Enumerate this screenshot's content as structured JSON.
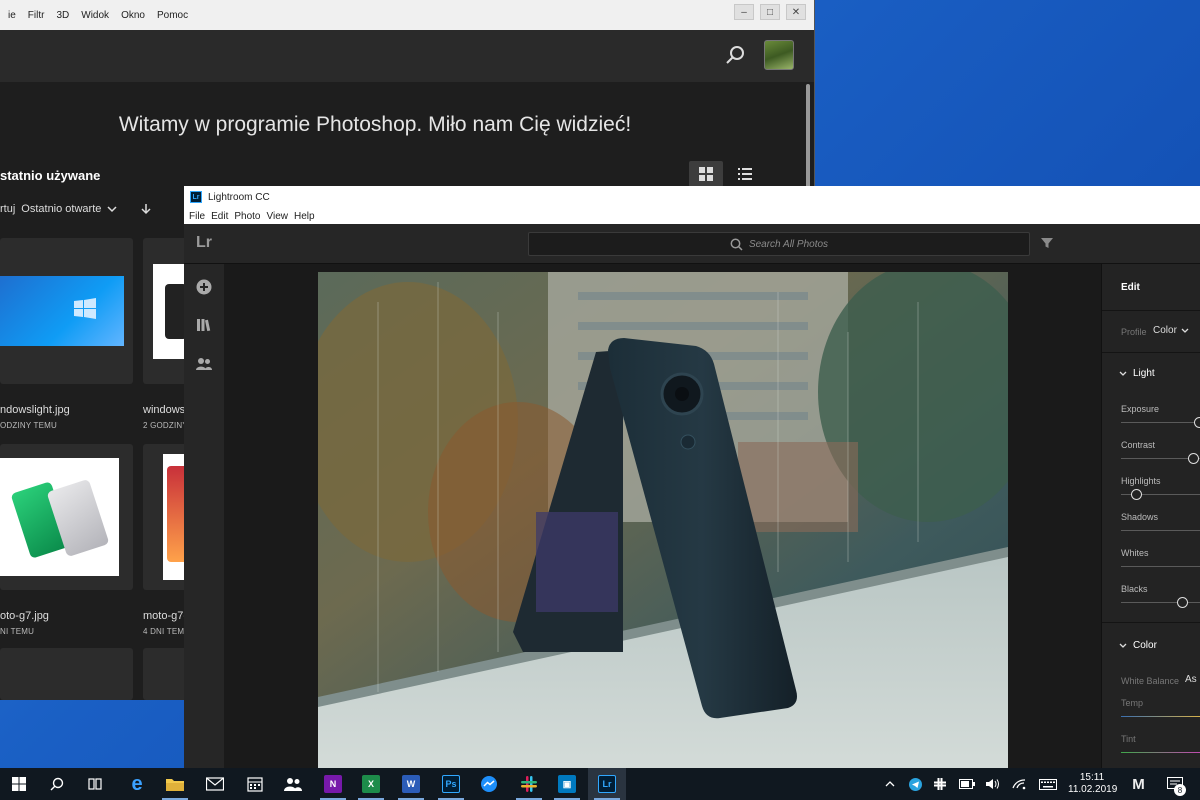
{
  "photoshop": {
    "menu": [
      "ie",
      "Filtr",
      "3D",
      "Widok",
      "Okno",
      "Pomoc"
    ],
    "welcome": "Witamy w programie Photoshop. Miło nam Cię widzieć!",
    "recent_heading": "statnio używane",
    "sort_prefix": "rtuj",
    "sort_value": "Ostatnio otwarte",
    "files": [
      {
        "name": "ndowslight.jpg",
        "meta": "ODZINY TEMU"
      },
      {
        "name": "windows",
        "meta": "2 GODZINY"
      },
      {
        "name": "oto-g7.jpg",
        "meta": "NI TEMU"
      },
      {
        "name": "moto-g7-",
        "meta": "4 DNI TEMU"
      }
    ]
  },
  "lightroom": {
    "title": "Lightroom CC",
    "brand": "Lr",
    "menu": [
      "File",
      "Edit",
      "Photo",
      "View",
      "Help"
    ],
    "search_placeholder": "Search All Photos",
    "panel": {
      "edit_label": "Edit",
      "profile_label": "Profile",
      "profile_value": "Color",
      "light_section": "Light",
      "sliders": [
        {
          "label": "Exposure",
          "value_fraction": 0.99
        },
        {
          "label": "Contrast",
          "value_fraction": 0.92
        },
        {
          "label": "Highlights",
          "value_fraction": 0.2
        },
        {
          "label": "Shadows",
          "value_fraction": null
        },
        {
          "label": "Whites",
          "value_fraction": null
        },
        {
          "label": "Blacks",
          "value_fraction": 0.78
        }
      ],
      "color_section": "Color",
      "white_balance_label": "White Balance",
      "white_balance_value": "As",
      "temp_label": "Temp",
      "tint_label": "Tint"
    }
  },
  "taskbar": {
    "apps": [
      "Start",
      "Search",
      "Task View",
      "Edge",
      "File Explorer",
      "Mail",
      "Calendar",
      "People",
      "OneNote",
      "Excel",
      "Word",
      "Photoshop",
      "Messenger",
      "Slack",
      "Trello",
      "Lightroom"
    ],
    "onenote_label": "N",
    "excel_label": "X",
    "word_label": "W",
    "ps_label": "Ps",
    "trello_label": "▣",
    "lr_label": "Lr",
    "time": "15:11",
    "date": "11.02.2019",
    "notification_count": "8",
    "mi_label": "M"
  },
  "colors": {
    "ps_blue": "#31a8ff",
    "lr_blue": "#31a8ff",
    "desktop_blue": "#1a5fc4",
    "taskbar": "#101820"
  }
}
